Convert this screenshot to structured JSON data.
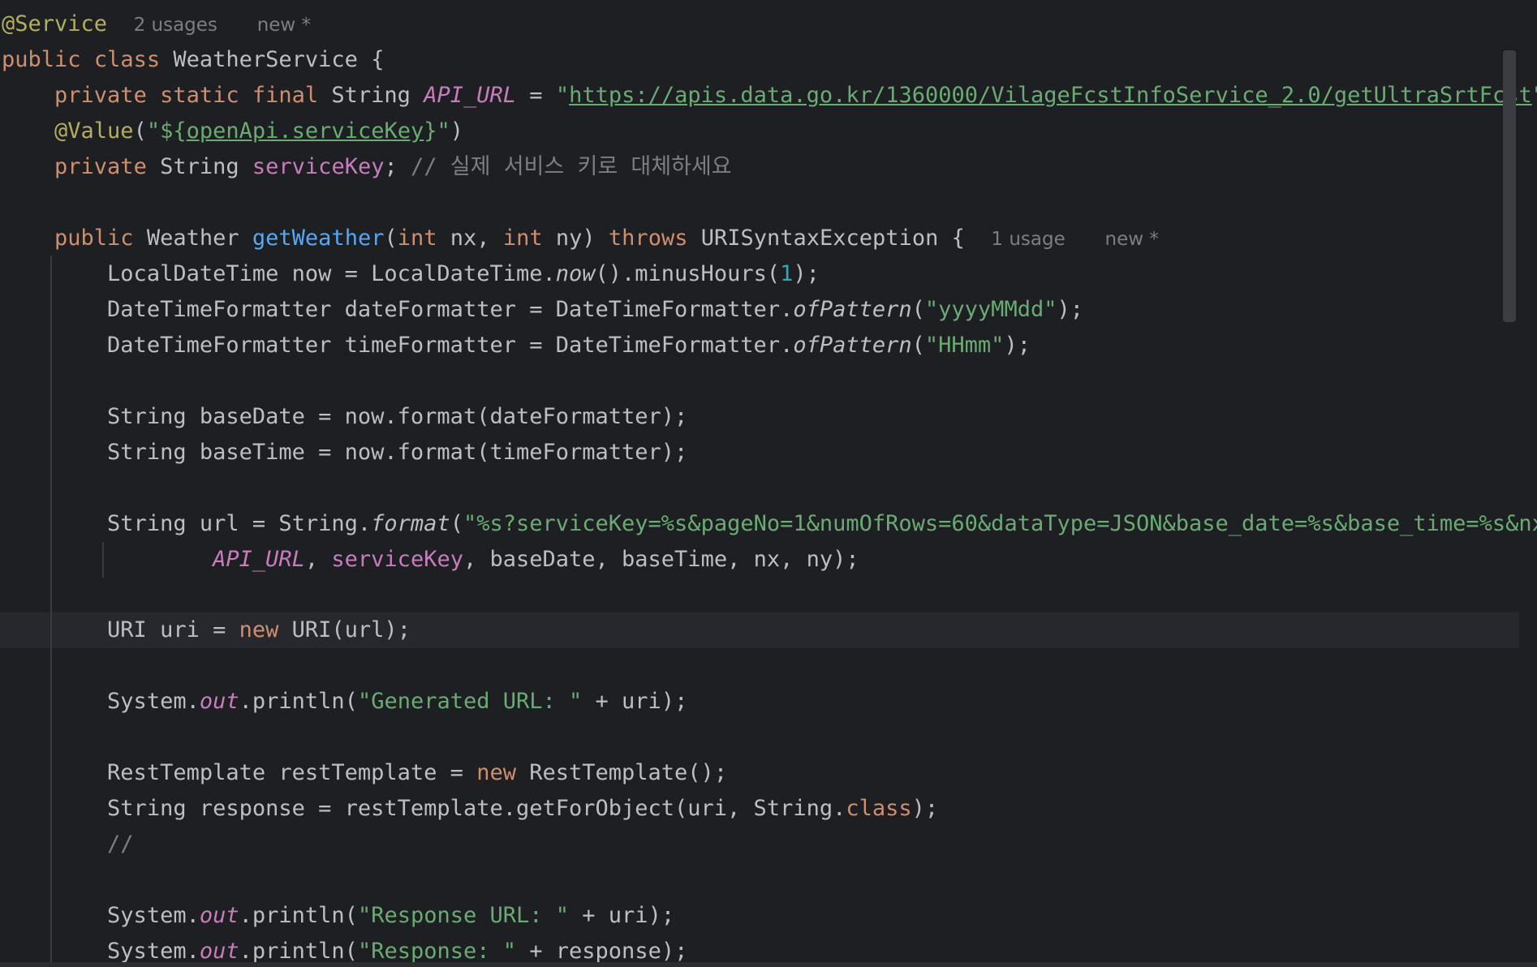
{
  "editor": {
    "hints": {
      "class_usages": "2 usages",
      "class_new": "new *",
      "method_usages": "1 usage",
      "method_new": "new *"
    },
    "l1": {
      "annotation": "@Service"
    },
    "l2": {
      "kw_public": "public",
      "kw_class": "class",
      "class_name": "WeatherService",
      "brace": "{"
    },
    "l3": {
      "modifiers": "private static final",
      "type": "String",
      "name": "API_URL",
      "eq": "=",
      "q_open": "\"",
      "url": "https://apis.data.go.kr/1360000/VilageFcstInfoService_2.0/getUltraSrtFcst",
      "q_close": "\""
    },
    "l4": {
      "annotation": "@Value",
      "p_open": "(",
      "q_open": "\"${",
      "key": "openApi.serviceKey",
      "q_close": "}\"",
      "p_close": ")"
    },
    "l5": {
      "kw": "private",
      "type": "String",
      "name": "serviceKey",
      "semi": ";",
      "comment": "// 실제 서비스 키로 대체하세요"
    },
    "l6": {
      "kw_public": "public",
      "ret_type": "Weather",
      "method": "getWeather",
      "p_open": "(",
      "kw_int1": "int",
      "nx": "nx,",
      "kw_int2": "int",
      "ny": "ny)",
      "kw_throws": "throws",
      "exc": "URISyntaxException",
      "brace": "{"
    },
    "l7": {
      "a": "LocalDateTime now = LocalDateTime.",
      "now": "now",
      "b": "().minusHours(",
      "num": "1",
      "c": ");"
    },
    "l8": {
      "a": "DateTimeFormatter dateFormatter = DateTimeFormatter.",
      "of": "ofPattern",
      "b": "(",
      "str": "\"yyyyMMdd\"",
      "c": ");"
    },
    "l9": {
      "a": "DateTimeFormatter timeFormatter = DateTimeFormatter.",
      "of": "ofPattern",
      "b": "(",
      "str": "\"HHmm\"",
      "c": ");"
    },
    "l10": {
      "text": "String baseDate = now.format(dateFormatter);"
    },
    "l11": {
      "text": "String baseTime = now.format(timeFormatter);"
    },
    "l12": {
      "a": "String url = String.",
      "fmt": "format",
      "b": "(",
      "str": "\"%s?serviceKey=%s&pageNo=1&numOfRows=60&dataType=JSON&base_date=%s&base_time=%s&nx"
    },
    "l13": {
      "api": "API_URL",
      "c1": ", ",
      "key": "serviceKey",
      "rest": ", baseDate, baseTime, nx, ny);"
    },
    "l14": {
      "a": "URI uri = ",
      "kw_new": "new",
      "b": " URI(url);"
    },
    "l15": {
      "a": "System.",
      "out": "out",
      "b": ".println(",
      "str": "\"Generated URL: \"",
      "c": " + uri);"
    },
    "l16": {
      "a": "RestTemplate restTemplate = ",
      "kw_new": "new",
      "b": " RestTemplate();"
    },
    "l17": {
      "a": "String response = restTemplate.getForObject(uri, String.",
      "kw_class": "class",
      "b": ");"
    },
    "l18": {
      "comment": "//"
    },
    "l19": {
      "a": "System.",
      "out": "out",
      "b": ".println(",
      "str": "\"Response URL: \"",
      "c": " + uri);"
    },
    "l20": {
      "a": "System.",
      "out": "out",
      "b": ".println(",
      "str": "\"Response: \"",
      "c": " + response);"
    }
  }
}
